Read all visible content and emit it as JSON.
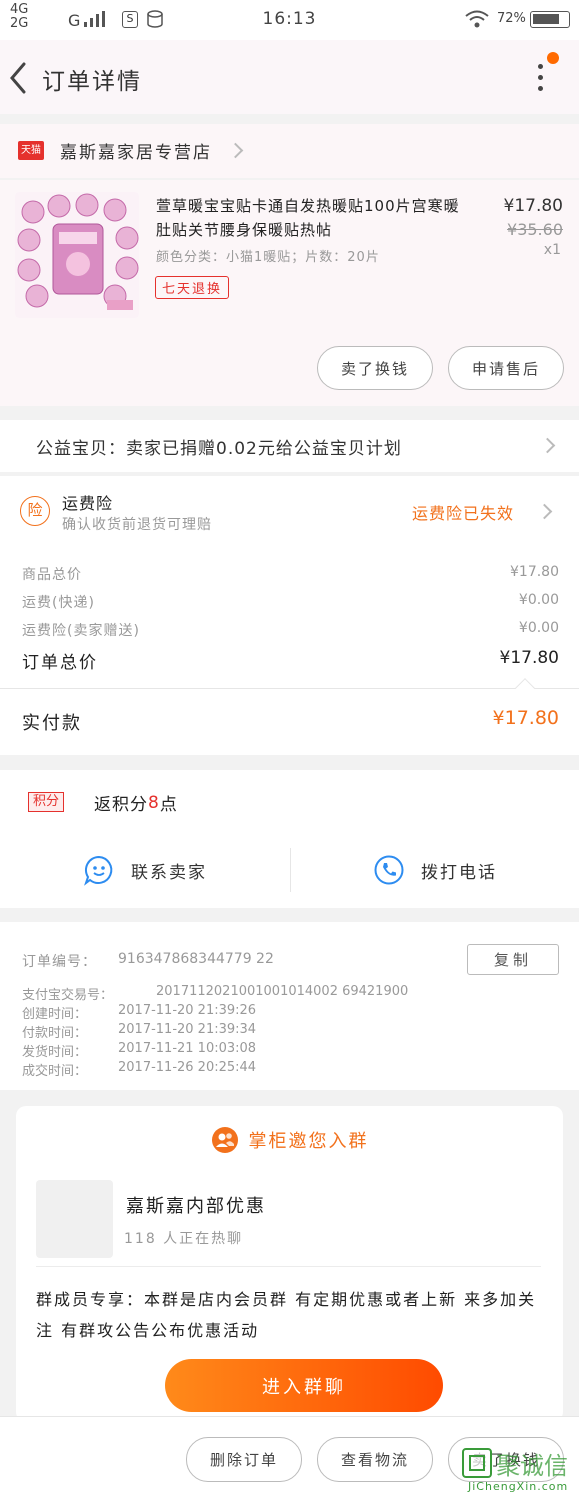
{
  "status_bar": {
    "network_1": "4G",
    "network_2": "2G",
    "signal_3": "G",
    "time": "16:13",
    "battery": "72%"
  },
  "header": {
    "title": "订单详情"
  },
  "store": {
    "badge": "天猫",
    "name": "嘉斯嘉家居专营店"
  },
  "product": {
    "title": "萱草暖宝宝贴卡通自发热暖贴100片宫寒暖肚贴关节腰身保暖贴热帖",
    "variant": "颜色分类：小猫1暖贴；片数：20片",
    "tag": "七天退换",
    "price": "¥17.80",
    "orig_price": "¥35.60",
    "qty": "x1",
    "btn_sell": "卖了换钱",
    "btn_after_sale": "申请售后"
  },
  "charity": {
    "text": "公益宝贝：卖家已捐赠0.02元给公益宝贝计划"
  },
  "insurance": {
    "icon_char": "险",
    "title": "运费险",
    "subtitle": "确认收货前退货可理赔",
    "status": "运费险已失效"
  },
  "pricing": {
    "rows": [
      {
        "label": "商品总价",
        "value": "¥17.80"
      },
      {
        "label": "运费(快递)",
        "value": "¥0.00"
      },
      {
        "label": "运费险(卖家赠送)",
        "value": "¥0.00"
      }
    ],
    "total_label": "订单总价",
    "total_value": "¥17.80",
    "paid_label": "实付款",
    "paid_value": "¥17.80"
  },
  "points": {
    "badge": "积分",
    "prefix": "返积分",
    "count": "8",
    "suffix": "点"
  },
  "contact": {
    "seller": "联系卖家",
    "phone": "拨打电话"
  },
  "order_info": {
    "number_label": "订单编号：",
    "number": "916347868344779 22",
    "copy": "复制",
    "rows": [
      {
        "label": "支付宝交易号：",
        "value": "2017112021001001014002 69421900"
      },
      {
        "label": "创建时间：",
        "value": "2017-11-20  21:39:26"
      },
      {
        "label": "付款时间：",
        "value": "2017-11-20  21:39:34"
      },
      {
        "label": "发货时间：",
        "value": "2017-11-21  10:03:08"
      },
      {
        "label": "成交时间：",
        "value": "2017-11-26  20:25:44"
      }
    ]
  },
  "group": {
    "header": "掌柜邀您入群",
    "name": "嘉斯嘉内部优惠",
    "members": "118 人正在热聊",
    "desc": "群成员专享：本群是店内会员群   有定期优惠或者上新   来多加关注   有群攻公告公布优惠活动",
    "join": "进入群聊"
  },
  "bottom_bar": {
    "delete": "删除订单",
    "logistics": "查看物流",
    "sell": "卖了换钱"
  },
  "watermark": {
    "brand": "聚诚信",
    "url": "JiChengXin.com"
  },
  "colors": {
    "accent": "#ff6a00",
    "tmall_red": "#e5312d",
    "link_blue": "#2d8cf0"
  }
}
